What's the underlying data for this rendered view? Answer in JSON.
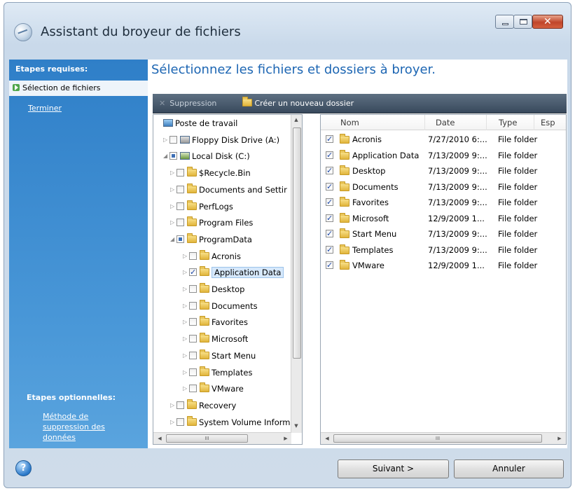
{
  "window": {
    "title": "Assistant du broyeur de fichiers"
  },
  "sidebar": {
    "required_title": "Etapes requises:",
    "required_steps": [
      {
        "label": "Sélection de fichiers",
        "active": true
      },
      {
        "label": "Terminer",
        "active": false
      }
    ],
    "optional_title": "Etapes optionnelles:",
    "optional_link": "Méthode de suppression des données"
  },
  "main": {
    "heading": "Sélectionnez les fichiers et dossiers à broyer."
  },
  "toolbar": {
    "delete_label": "Suppression",
    "new_folder_label": "Créer un nouveau dossier"
  },
  "tree": {
    "items": [
      {
        "label": "Poste de travail",
        "icon": "computer-icon",
        "level": 0,
        "check": "none"
      },
      {
        "label": "Floppy Disk Drive (A:)",
        "icon": "floppy-icon",
        "level": 1,
        "check": "off"
      },
      {
        "label": "Local Disk (C:)",
        "icon": "drive-icon",
        "level": 1,
        "check": "partial"
      },
      {
        "label": "$Recycle.Bin",
        "icon": "folder-icon",
        "level": 2,
        "check": "off"
      },
      {
        "label": "Documents and Settir",
        "icon": "folder-icon",
        "level": 2,
        "check": "off"
      },
      {
        "label": "PerfLogs",
        "icon": "folder-icon",
        "level": 2,
        "check": "off"
      },
      {
        "label": "Program Files",
        "icon": "folder-icon",
        "level": 2,
        "check": "off"
      },
      {
        "label": "ProgramData",
        "icon": "folder-icon",
        "level": 2,
        "check": "partial"
      },
      {
        "label": "Acronis",
        "icon": "folder-icon",
        "level": 3,
        "check": "off"
      },
      {
        "label": "Application Data",
        "icon": "folder-icon",
        "level": 3,
        "check": "on",
        "selected": true
      },
      {
        "label": "Desktop",
        "icon": "folder-icon",
        "level": 3,
        "check": "off"
      },
      {
        "label": "Documents",
        "icon": "folder-icon",
        "level": 3,
        "check": "off"
      },
      {
        "label": "Favorites",
        "icon": "folder-icon",
        "level": 3,
        "check": "off"
      },
      {
        "label": "Microsoft",
        "icon": "folder-icon",
        "level": 3,
        "check": "off"
      },
      {
        "label": "Start Menu",
        "icon": "folder-icon",
        "level": 3,
        "check": "off"
      },
      {
        "label": "Templates",
        "icon": "folder-icon",
        "level": 3,
        "check": "off"
      },
      {
        "label": "VMware",
        "icon": "folder-icon",
        "level": 3,
        "check": "off"
      },
      {
        "label": "Recovery",
        "icon": "folder-icon",
        "level": 2,
        "check": "off"
      },
      {
        "label": "System Volume Inform",
        "icon": "folder-icon",
        "level": 2,
        "check": "off"
      }
    ],
    "hscroll_label": "III"
  },
  "files": {
    "columns": [
      "Nom",
      "Date",
      "Type",
      "Esp"
    ],
    "rows": [
      {
        "name": "Acronis",
        "date": "7/27/2010 6:...",
        "type": "File folder"
      },
      {
        "name": "Application Data",
        "date": "7/13/2009 9:...",
        "type": "File folder"
      },
      {
        "name": "Desktop",
        "date": "7/13/2009 9:...",
        "type": "File folder"
      },
      {
        "name": "Documents",
        "date": "7/13/2009 9:...",
        "type": "File folder"
      },
      {
        "name": "Favorites",
        "date": "7/13/2009 9:...",
        "type": "File folder"
      },
      {
        "name": "Microsoft",
        "date": "12/9/2009 1...",
        "type": "File folder"
      },
      {
        "name": "Start Menu",
        "date": "7/13/2009 9:...",
        "type": "File folder"
      },
      {
        "name": "Templates",
        "date": "7/13/2009 9:...",
        "type": "File folder"
      },
      {
        "name": "VMware",
        "date": "12/9/2009 1...",
        "type": "File folder"
      }
    ],
    "hscroll_label": "III"
  },
  "footer": {
    "next_label": "Suivant >",
    "cancel_label": "Annuler"
  },
  "colors": {
    "sidebar": "#3a8ad0",
    "heading": "#1d66b3",
    "toolbar": "#4a5b6e"
  }
}
